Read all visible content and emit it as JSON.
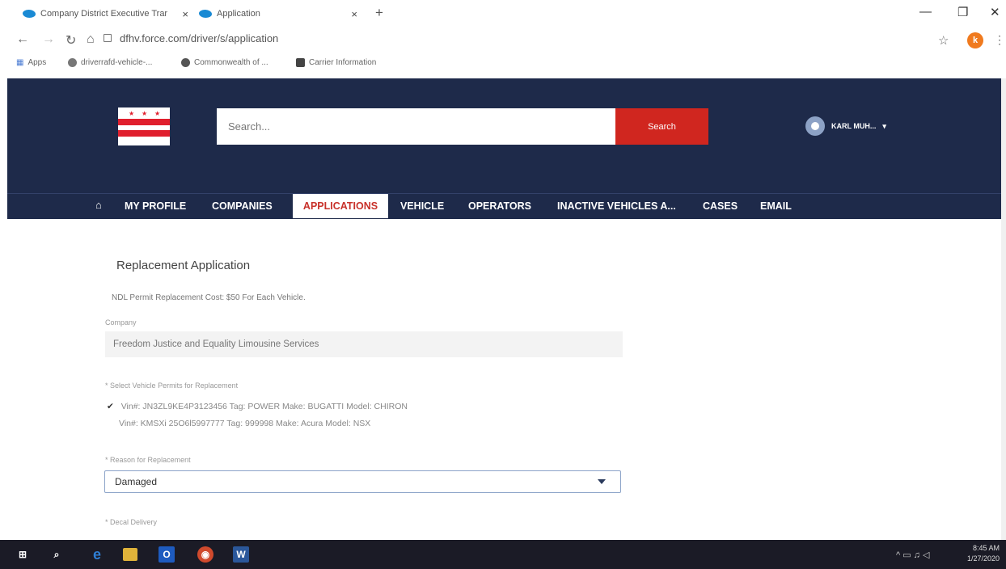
{
  "browser": {
    "tabs": [
      {
        "label": "Company District Executive Trar",
        "close": "×"
      },
      {
        "label": "Application",
        "close": "×"
      }
    ],
    "new_tab": "+",
    "url": "dfhv.force.com/driver/s/application",
    "profile_initial": "k",
    "bookmarks": [
      "Apps",
      "driverrafd-vehicle-...",
      "Commonwealth of ...",
      "Carrier Information"
    ]
  },
  "header": {
    "search_placeholder": "Search...",
    "search_button": "Search",
    "user_name": "KARL MUH...",
    "user_caret": "▾"
  },
  "nav": {
    "home_icon": "⌂",
    "items": [
      "MY PROFILE",
      "COMPANIES",
      "APPLICATIONS",
      "VEHICLE",
      "OPERATORS",
      "INACTIVE VEHICLES A...",
      "CASES",
      "EMAIL"
    ],
    "active": "APPLICATIONS"
  },
  "form": {
    "title": "Replacement Application",
    "cost_note": "NDL Permit Replacement Cost: $50 For Each Vehicle.",
    "company_label": "Company",
    "company_value": "Freedom Justice and Equality Limousine Services",
    "permits_label": "Select Vehicle Permits for Replacement",
    "permits": [
      {
        "checked": true,
        "check_mark": "✔",
        "text": "Vin#: JN3ZL9KE4P3123456 Tag: POWER Make: BUGATTI Model: CHIRON"
      },
      {
        "checked": false,
        "text": "Vin#: KMSXi 25O6l5997777 Tag: 999998 Make: Acura Model: NSX"
      }
    ],
    "reason_label": "Reason for Replacement",
    "reason_value": "Damaged",
    "decal_label": "Decal Delivery",
    "required_mark": "*"
  },
  "taskbar": {
    "time": "8:45 AM",
    "date": "1/27/2020",
    "apps": [
      "start",
      "search",
      "edge",
      "file-explorer",
      "outlook",
      "chrome",
      "word"
    ]
  }
}
